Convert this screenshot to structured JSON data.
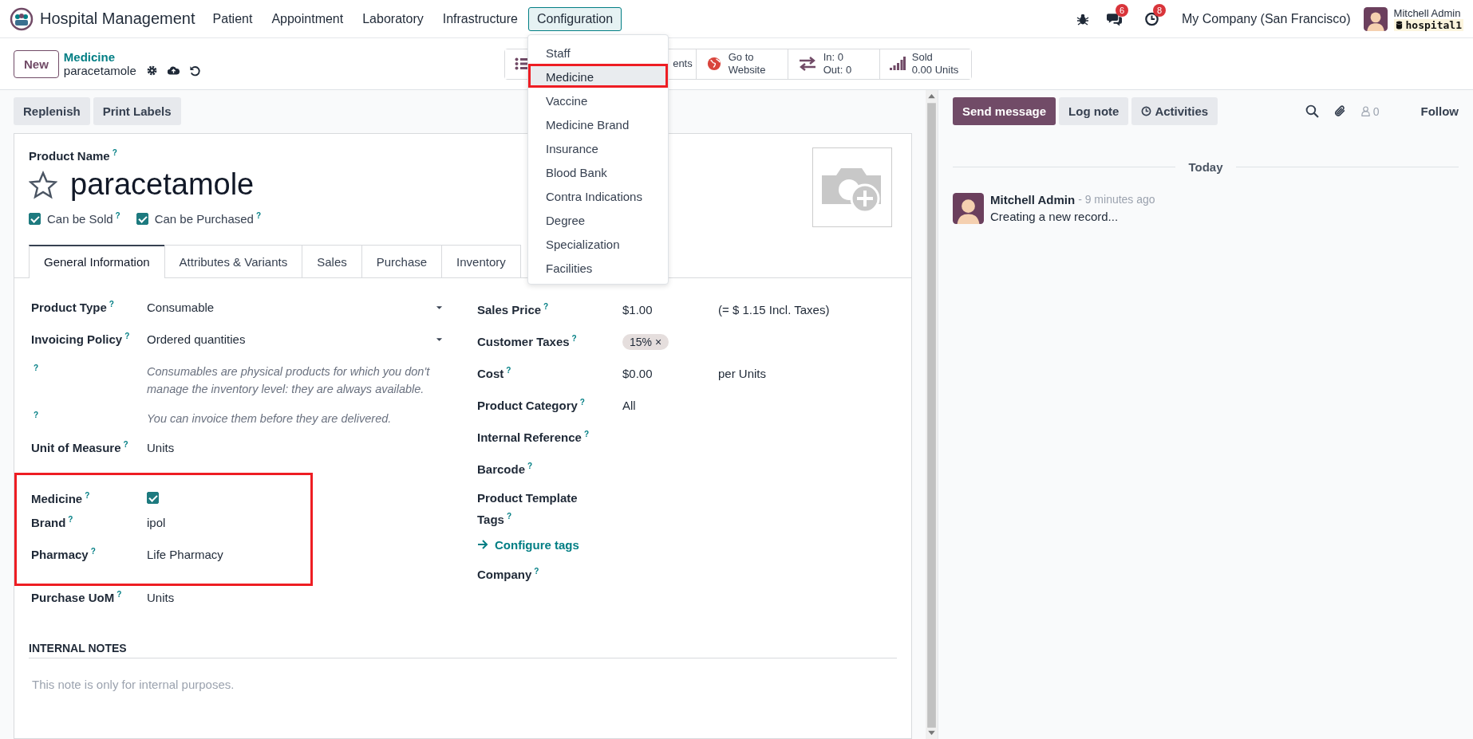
{
  "navbar": {
    "app_name": "Hospital Management",
    "menus": [
      {
        "label": "Patient",
        "selected": false
      },
      {
        "label": "Appointment",
        "selected": false
      },
      {
        "label": "Laboratory",
        "selected": false
      },
      {
        "label": "Infrastructure",
        "selected": false
      },
      {
        "label": "Configuration",
        "selected": true
      }
    ],
    "messages_badge": "6",
    "activities_badge": "8",
    "company": "My Company (San Francisco)",
    "user": "Mitchell Admin",
    "database": "hospital1"
  },
  "config_menu": {
    "items": [
      {
        "label": "Staff",
        "selected": false,
        "highlighted": false
      },
      {
        "label": "Medicine",
        "selected": true,
        "highlighted": true
      },
      {
        "label": "Vaccine",
        "selected": false,
        "highlighted": false
      },
      {
        "label": "Medicine Brand",
        "selected": false,
        "highlighted": false
      },
      {
        "label": "Insurance",
        "selected": false,
        "highlighted": false
      },
      {
        "label": "Blood Bank",
        "selected": false,
        "highlighted": false
      },
      {
        "label": "Contra Indications",
        "selected": false,
        "highlighted": false
      },
      {
        "label": "Degree",
        "selected": false,
        "highlighted": false
      },
      {
        "label": "Specialization",
        "selected": false,
        "highlighted": false
      },
      {
        "label": "Facilities",
        "selected": false,
        "highlighted": false
      }
    ]
  },
  "control_panel": {
    "new_button": "New",
    "breadcrumb": "Medicine",
    "record": "paracetamole",
    "stat_buttons": [
      {
        "kind": "list",
        "lines": [
          "ents"
        ]
      },
      {
        "kind": "globe",
        "lines": [
          "Go to",
          "Website"
        ]
      },
      {
        "kind": "transfer",
        "lines": [
          "In: 0",
          "Out: 0"
        ]
      },
      {
        "kind": "chart",
        "lines": [
          "Sold",
          "0.00 Units"
        ]
      }
    ]
  },
  "action_buttons": [
    "Replenish",
    "Print Labels"
  ],
  "form": {
    "product_name_label": "Product Name",
    "help": "?",
    "title": "paracetamole",
    "favorite": false,
    "checkboxes": [
      {
        "label": "Can be Sold",
        "checked": true,
        "help": "?"
      },
      {
        "label": "Can be Purchased",
        "checked": true,
        "help": "?"
      }
    ],
    "tabs": [
      {
        "label": "General Information",
        "selected": true
      },
      {
        "label": "Attributes & Variants",
        "selected": false
      },
      {
        "label": "Sales",
        "selected": false
      },
      {
        "label": "Purchase",
        "selected": false
      },
      {
        "label": "Inventory",
        "selected": false
      }
    ],
    "left_groups": [
      {
        "highlighted": false,
        "fields": [
          {
            "kind": "select",
            "label": "Product Type",
            "help": "?",
            "value": "Consumable"
          },
          {
            "kind": "select",
            "label": "Invoicing Policy",
            "help": "?",
            "value": "Ordered quantities"
          },
          {
            "kind": "note",
            "help": "?",
            "value": "Consumables are physical products for which you don't manage the inventory level: they are always available."
          },
          {
            "kind": "note",
            "help": "?",
            "value": "You can invoice them before they are delivered."
          },
          {
            "kind": "text",
            "label": "Unit of Measure",
            "help": "?",
            "value": "Units"
          }
        ]
      },
      {
        "highlighted": true,
        "fields": [
          {
            "kind": "checkbox",
            "label": "Medicine",
            "help": "?",
            "checked": true
          },
          {
            "kind": "text",
            "label": "Brand",
            "help": "?",
            "value": "ipol"
          },
          {
            "kind": "text",
            "label": "Pharmacy",
            "help": "?",
            "value": "Life Pharmacy"
          }
        ]
      },
      {
        "highlighted": false,
        "fields": [
          {
            "kind": "text",
            "label": "Purchase UoM",
            "help": "?",
            "value": "Units"
          }
        ]
      }
    ],
    "right_fields": [
      {
        "kind": "text",
        "label": "Sales Price",
        "help": "?",
        "value": "$1.00",
        "extra": "(= $ 1.15 Incl. Taxes)"
      },
      {
        "kind": "tag",
        "label": "Customer Taxes",
        "help": "?",
        "value": "15%",
        "remove": "×"
      },
      {
        "kind": "text",
        "label": "Cost",
        "help": "?",
        "value": "$0.00",
        "extra": "per Units"
      },
      {
        "kind": "text",
        "label": "Product Category",
        "help": "?",
        "value": "All"
      },
      {
        "kind": "text",
        "label": "Internal Reference",
        "help": "?"
      },
      {
        "kind": "text",
        "label": "Barcode",
        "help": "?"
      },
      {
        "kind": "text",
        "label": "Product Template Tags",
        "help": "?"
      },
      {
        "kind": "link",
        "value": "Configure tags"
      },
      {
        "kind": "text",
        "label": "Company",
        "help": "?"
      }
    ],
    "notes": {
      "heading": "INTERNAL NOTES",
      "placeholder": "This note is only for internal purposes."
    }
  },
  "chatter": {
    "buttons": [
      {
        "label": "Send message",
        "kind": "primary"
      },
      {
        "label": "Log note",
        "kind": "secondary"
      },
      {
        "label": "Activities",
        "kind": "activities"
      }
    ],
    "followers_count": "0",
    "follow": "Follow",
    "date_separator": "Today",
    "messages": [
      {
        "author": "Mitchell Admin",
        "time": "- 9 minutes ago",
        "body": "Creating a new record..."
      }
    ]
  }
}
